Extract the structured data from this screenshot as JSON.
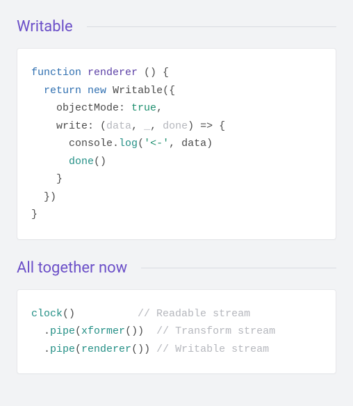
{
  "sections": [
    {
      "title": "Writable"
    },
    {
      "title": "All together now"
    }
  ],
  "code1": {
    "l1": {
      "kw1": "function",
      "name": "renderer",
      "rest": " () {"
    },
    "l2": {
      "kw1": "return",
      "kw2": "new",
      "cls": "Writable",
      "rest": "({"
    },
    "l3": {
      "key": "objectMode",
      "colon": ": ",
      "val": "true",
      "comma": ","
    },
    "l4": {
      "key": "write",
      "colon": ": (",
      "a1": "data",
      "c1": ", ",
      "a2": "_",
      "c2": ", ",
      "a3": "done",
      "rest": ") => {"
    },
    "l5": {
      "obj": "console",
      "dot": ".",
      "fn": "log",
      "open": "(",
      "str": "'<-'",
      "c": ", ",
      "arg": "data",
      "close": ")"
    },
    "l6": {
      "fn": "done",
      "paren": "()"
    },
    "l7": "    }",
    "l8": "  })",
    "l9": "}"
  },
  "code2": {
    "l1": {
      "fn": "clock",
      "paren": "()",
      "pad": "          ",
      "cm": "// Readable stream"
    },
    "l2": {
      "pre": "  .",
      "pipe": "pipe",
      "open": "(",
      "inner": "xformer",
      "innerp": "()",
      "close": ")",
      "pad": "  ",
      "cm": "// Transform stream"
    },
    "l3": {
      "pre": "  .",
      "pipe": "pipe",
      "open": "(",
      "inner": "renderer",
      "innerp": "()",
      "close": ")",
      "pad": " ",
      "cm": "// Writable stream"
    }
  }
}
